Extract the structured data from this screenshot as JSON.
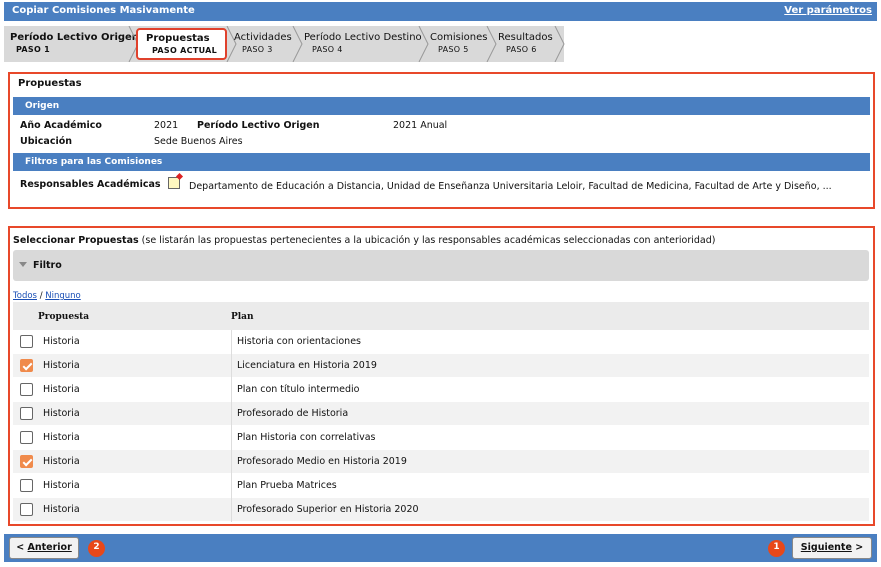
{
  "window": {
    "title": "Copiar Comisiones Masivamente",
    "params_link": "Ver parámetros"
  },
  "steps": [
    {
      "name": "Período Lectivo Origen",
      "sub": "PASO 1"
    },
    {
      "name": "Propuestas",
      "sub": "PASO ACTUAL"
    },
    {
      "name": "Actividades",
      "sub": "PASO 3"
    },
    {
      "name": "Período Lectivo Destino",
      "sub": "PASO 4"
    },
    {
      "name": "Comisiones",
      "sub": "PASO 5"
    },
    {
      "name": "Resultados",
      "sub": "PASO 6"
    }
  ],
  "summary": {
    "title": "Propuestas",
    "origen_header": "Origen",
    "anio_label": "Año Académico",
    "anio_value": "2021",
    "periodo_label": "Período Lectivo Origen",
    "periodo_value": "2021 Anual",
    "ubicacion_label": "Ubicación",
    "ubicacion_value": "Sede Buenos Aires",
    "filtros_header": "Filtros para las Comisiones",
    "responsables_label": "Responsables Académicas",
    "responsables_value": "Departamento de Educación a Distancia, Unidad de Enseñanza Universitaria Leloir, Facultad de Medicina, Facultad de Arte y Diseño,  ..."
  },
  "selection": {
    "title": "Seleccionar Propuestas",
    "note": "(se listarán las propuestas pertenecientes a la ubicación y las responsables académicas seleccionadas con anterioridad)",
    "filter_label": "Filtro",
    "all_link": "Todos",
    "separator": "/",
    "none_link": "Ninguno",
    "col_propuesta": "Propuesta",
    "col_plan": "Plan",
    "rows": [
      {
        "propuesta": "Historia",
        "plan": "Historia con orientaciones",
        "checked": false
      },
      {
        "propuesta": "Historia",
        "plan": "Licenciatura en Historia 2019",
        "checked": true
      },
      {
        "propuesta": "Historia",
        "plan": "Plan con título intermedio",
        "checked": false
      },
      {
        "propuesta": "Historia",
        "plan": "Profesorado de Historia",
        "checked": false
      },
      {
        "propuesta": "Historia",
        "plan": "Plan Historia con correlativas",
        "checked": false
      },
      {
        "propuesta": "Historia",
        "plan": "Profesorado Medio en Historia 2019",
        "checked": true
      },
      {
        "propuesta": "Historia",
        "plan": "Plan Prueba Matrices",
        "checked": false
      },
      {
        "propuesta": "Historia",
        "plan": "Profesorado Superior en Historia 2020",
        "checked": false
      }
    ]
  },
  "footer": {
    "prev_prefix": "< ",
    "prev_label": "Anterior",
    "next_label": "Siguiente",
    "next_suffix": " >",
    "badge_prev": "2",
    "badge_next": "1"
  },
  "colors": {
    "accent": "#4a7fc1",
    "highlight": "#e8482a",
    "check": "#f08a4b"
  }
}
